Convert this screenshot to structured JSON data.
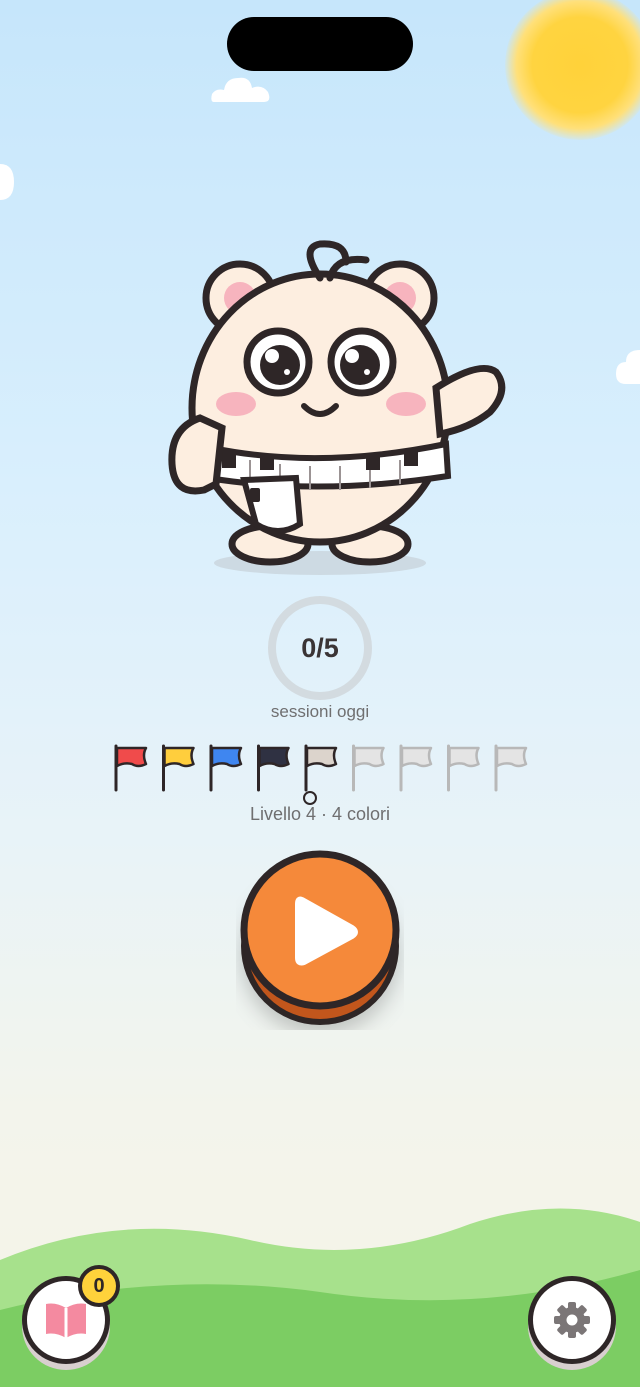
{
  "progress": {
    "done": 0,
    "goal": 5,
    "text": "0/5",
    "label": "sessioni oggi"
  },
  "level": {
    "label": "Livello 4 · 4 colori",
    "current_index": 4,
    "flags": [
      "red",
      "yellow",
      "blue",
      "navy",
      "beige",
      "gray",
      "gray",
      "gray",
      "gray"
    ]
  },
  "colors": {
    "red": "#f04b4b",
    "yellow": "#ffce3d",
    "blue": "#3f86f0",
    "navy": "#2f3142",
    "beige": "#dcd4cc",
    "gray": "#e4e4e4",
    "play": "#f5893a",
    "play_shadow": "#c2561b",
    "outline": "#2e2627"
  },
  "bottom": {
    "notes_badge_count": "0"
  },
  "icons": {
    "play": "play-icon",
    "book": "book-icon",
    "settings": "gear-icon"
  }
}
